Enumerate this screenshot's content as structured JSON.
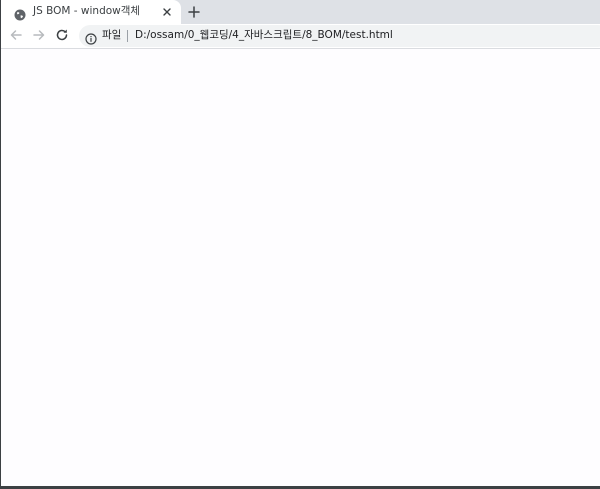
{
  "browser": {
    "tab": {
      "title": "JS BOM - window객체",
      "favicon": "globe-icon",
      "close_icon": "close-icon"
    },
    "new_tab_icon": "plus-icon",
    "toolbar": {
      "back_icon": "arrow-left-icon",
      "forward_icon": "arrow-right-icon",
      "reload_icon": "reload-icon"
    },
    "omnibox": {
      "security_icon": "info-icon",
      "security_label": "파일",
      "url": "D:/ossam/0_웹코딩/4_자바스크립트/8_BOM/test.html"
    }
  },
  "colors": {
    "tabstrip_bg": "#dee1e6",
    "omnibox_bg": "#f1f3f4",
    "content_bg": "#fefdff"
  }
}
